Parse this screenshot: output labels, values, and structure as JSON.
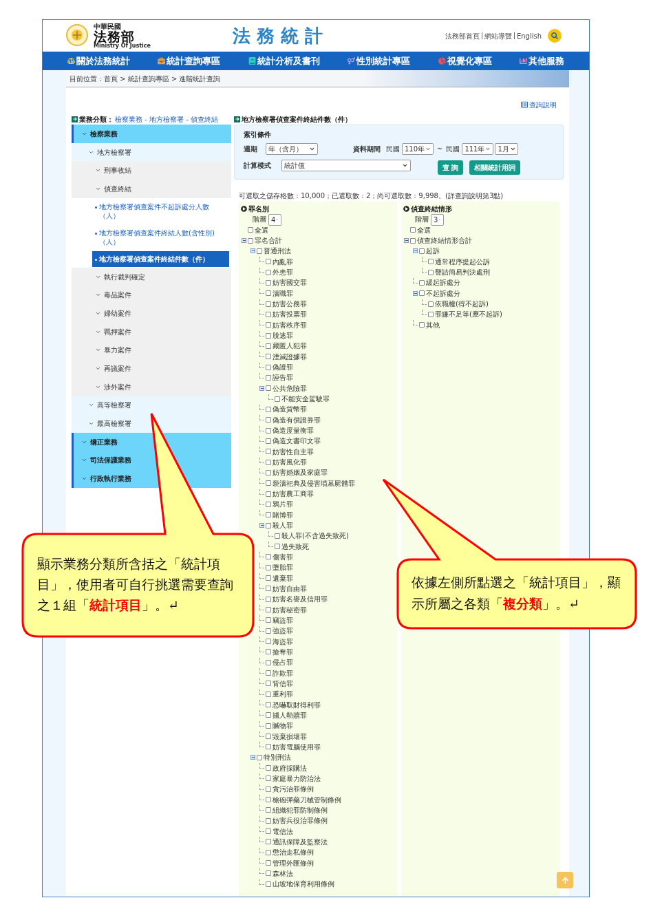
{
  "header": {
    "logo": {
      "line_1": "中華民國",
      "line_2": "法務部",
      "line_3": "Ministry Of Justice"
    },
    "title": "法 務 統 計",
    "links": [
      "法務部首頁",
      "網站導覽",
      "English"
    ]
  },
  "nav": [
    {
      "label": "關於法務統計"
    },
    {
      "label": "統計查詢專區"
    },
    {
      "label": "統計分析及書刊"
    },
    {
      "label": "性別統計專區"
    },
    {
      "label": "視覺化專區"
    },
    {
      "label": "其他服務"
    }
  ],
  "breadcrumb": "目前位置：首頁 > 統計查詢專區 > 進階統計查詢",
  "help_link": "查詢說明",
  "category": {
    "label": "業務分類：",
    "path": "檢察業務 - 地方檢察署 - 偵查終結"
  },
  "report_title": "地方檢察署偵查案件終結件數（件）",
  "sidebar": [
    {
      "label": "檢察業務",
      "children": [
        {
          "label": "地方檢察署",
          "children": [
            {
              "label": "刑事收結"
            },
            {
              "label": "偵查終結",
              "children": [
                {
                  "label": "地方檢察署偵查案件不起訴處分人數（人）",
                  "selected": false
                },
                {
                  "label": "地方檢察署偵查案件終結人數(含性別)（人）",
                  "selected": false
                },
                {
                  "label": "地方檢察署偵查案件終結件數（件）",
                  "selected": true
                }
              ]
            },
            {
              "label": "執行裁判確定"
            },
            {
              "label": "毒品案件"
            },
            {
              "label": "婦幼案件"
            },
            {
              "label": "羈押案件"
            },
            {
              "label": "暴力案件"
            },
            {
              "label": "再議案件"
            },
            {
              "label": "涉外案件"
            }
          ]
        },
        {
          "label": "高等檢察署"
        },
        {
          "label": "最高檢察署"
        }
      ]
    },
    {
      "label": "矯正業務"
    },
    {
      "label": "司法保護業務"
    },
    {
      "label": "行政執行業務"
    }
  ],
  "query": {
    "title": "索引條件",
    "period": {
      "label": "週期",
      "value": "年（含月）"
    },
    "data_period": {
      "label": "資料期間",
      "from_prefix": "民國",
      "from_year": "110年",
      "separator": "~",
      "to_prefix": "民國",
      "to_year": "111年",
      "to_month": "1月"
    },
    "mode": {
      "label": "計算模式",
      "value": "統計值"
    },
    "buttons": [
      "查 詢",
      "相關統計用詞"
    ]
  },
  "selection_info": "可選取之儲存格數：10,000；已選取數：2；尚可選取數：9,998。(詳查詢說明第3點)",
  "trees": [
    {
      "title": "罪名別",
      "level_label": "階層",
      "level_value": "4",
      "select_all": {
        "label": "全選",
        "checked": false
      },
      "nodes": [
        {
          "label": "罪名合計",
          "checked": false,
          "expanded": true,
          "children": [
            {
              "label": "普通刑法",
              "checked": false,
              "expanded": true,
              "children": [
                {
                  "label": "內亂罪",
                  "checked": false
                },
                {
                  "label": "外患罪",
                  "checked": false
                },
                {
                  "label": "妨害國交罪",
                  "checked": false
                },
                {
                  "label": "瀆職罪",
                  "checked": false
                },
                {
                  "label": "妨害公務罪",
                  "checked": false
                },
                {
                  "label": "妨害投票罪",
                  "checked": false
                },
                {
                  "label": "妨害秩序罪",
                  "checked": false
                },
                {
                  "label": "脫逃罪",
                  "checked": false
                },
                {
                  "label": "藏匿人犯罪",
                  "checked": false
                },
                {
                  "label": "湮滅證據罪",
                  "checked": false
                },
                {
                  "label": "偽證罪",
                  "checked": false
                },
                {
                  "label": "誣告罪",
                  "checked": false
                },
                {
                  "label": "公共危險罪",
                  "checked": false,
                  "expanded": true,
                  "children": [
                    {
                      "label": "不能安全駕駛罪",
                      "checked": false
                    }
                  ]
                },
                {
                  "label": "偽造貨幣罪",
                  "checked": false
                },
                {
                  "label": "偽造有價證券罪",
                  "checked": false
                },
                {
                  "label": "偽造度量衡罪",
                  "checked": false
                },
                {
                  "label": "偽造文書印文罪",
                  "checked": false
                },
                {
                  "label": "妨害性自主罪",
                  "checked": false
                },
                {
                  "label": "妨害風化罪",
                  "checked": false
                },
                {
                  "label": "妨害婚姻及家庭罪",
                  "checked": false
                },
                {
                  "label": "褻瀆祀典及侵害墳墓屍體罪",
                  "checked": false
                },
                {
                  "label": "妨害農工商罪",
                  "checked": false
                },
                {
                  "label": "鴉片罪",
                  "checked": false
                },
                {
                  "label": "賭博罪",
                  "checked": false
                },
                {
                  "label": "殺人罪",
                  "checked": false,
                  "expanded": true,
                  "children": [
                    {
                      "label": "殺人罪(不含過失致死)",
                      "checked": false
                    },
                    {
                      "label": "過失致死",
                      "checked": false
                    }
                  ]
                },
                {
                  "label": "傷害罪",
                  "checked": false
                },
                {
                  "label": "墮胎罪",
                  "checked": false
                },
                {
                  "label": "遺棄罪",
                  "checked": false
                },
                {
                  "label": "妨害自由罪",
                  "checked": false
                },
                {
                  "label": "妨害名譽及信用罪",
                  "checked": false
                },
                {
                  "label": "妨害秘密罪",
                  "checked": false
                },
                {
                  "label": "竊盜罪",
                  "checked": false
                },
                {
                  "label": "強盜罪",
                  "checked": false
                },
                {
                  "label": "海盜罪",
                  "checked": false
                },
                {
                  "label": "搶奪罪",
                  "checked": false
                },
                {
                  "label": "侵占罪",
                  "checked": false
                },
                {
                  "label": "詐欺罪",
                  "checked": false
                },
                {
                  "label": "背信罪",
                  "checked": false
                },
                {
                  "label": "重利罪",
                  "checked": false
                },
                {
                  "label": "恐嚇取財得利罪",
                  "checked": false
                },
                {
                  "label": "擄人勒贖罪",
                  "checked": false
                },
                {
                  "label": "贓物罪",
                  "checked": false
                },
                {
                  "label": "毀棄損壞罪",
                  "checked": false
                },
                {
                  "label": "妨害電腦使用罪",
                  "checked": false
                }
              ]
            },
            {
              "label": "特別刑法",
              "checked": false,
              "expanded": true,
              "children": [
                {
                  "label": "政府採購法",
                  "checked": false
                },
                {
                  "label": "家庭暴力防治法",
                  "checked": false
                },
                {
                  "label": "貪污治罪條例",
                  "checked": false
                },
                {
                  "label": "槍砲彈藥刀械管制條例",
                  "checked": false
                },
                {
                  "label": "組織犯罪防制條例",
                  "checked": false
                },
                {
                  "label": "妨害兵役治罪條例",
                  "checked": false
                },
                {
                  "label": "電信法",
                  "checked": false
                },
                {
                  "label": "通訊保障及監察法",
                  "checked": false
                },
                {
                  "label": "懲治走私條例",
                  "checked": false
                },
                {
                  "label": "管理外匯條例",
                  "checked": false
                },
                {
                  "label": "森林法",
                  "checked": false
                },
                {
                  "label": "山坡地保育利用條例",
                  "checked": false
                }
              ]
            }
          ]
        }
      ]
    },
    {
      "title": "偵查終結情形",
      "level_label": "階層",
      "level_value": "3",
      "select_all": {
        "label": "全選",
        "checked": false
      },
      "nodes": [
        {
          "label": "偵查終結情形合計",
          "checked": false,
          "expanded": true,
          "children": [
            {
              "label": "起訴",
              "checked": false,
              "expanded": true,
              "children": [
                {
                  "label": "通常程序提起公訴",
                  "checked": false
                },
                {
                  "label": "聲請簡易判決處刑",
                  "checked": false
                }
              ]
            },
            {
              "label": "緩起訴處分",
              "checked": false
            },
            {
              "label": "不起訴處分",
              "checked": false,
              "expanded": true,
              "children": [
                {
                  "label": "依職權(得不起訴)",
                  "checked": false
                },
                {
                  "label": "罪嫌不足等(應不起訴)",
                  "checked": false
                }
              ]
            },
            {
              "label": "其他",
              "checked": false
            }
          ]
        }
      ]
    }
  ],
  "callouts": [
    {
      "text": "顯示業務分類所含括之「統計項目」，使用者可自行挑選需要查詢之１組「**統計項目**」。↵"
    },
    {
      "text": "依據左側所點選之「統計項目」，顯示所屬之各類「**複分類**」。↵"
    }
  ]
}
